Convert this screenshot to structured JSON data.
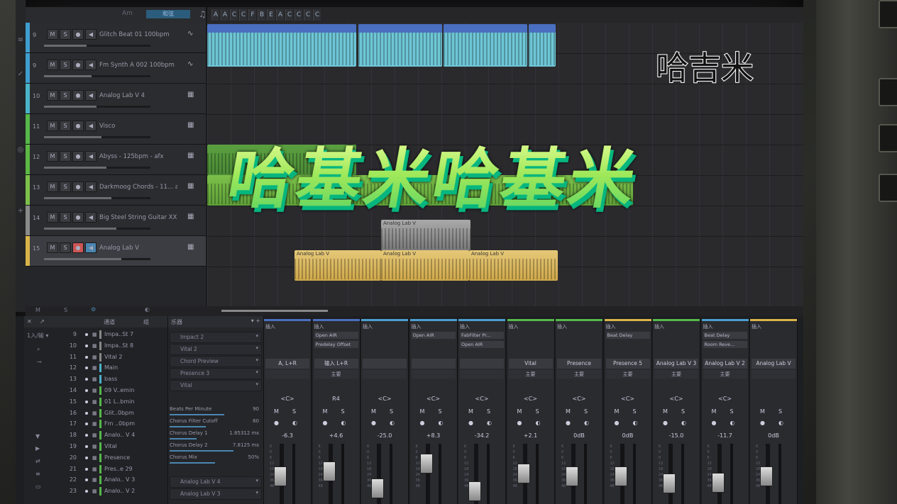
{
  "header": {
    "key_label": "Am",
    "mode_label": "和弦",
    "chords": [
      "A",
      "A",
      "C",
      "C",
      "F",
      "B",
      "E",
      "A",
      "C",
      "C",
      "C",
      "C"
    ]
  },
  "tracks": [
    {
      "num": "9",
      "name": "Glitch Beat 01 100bpm",
      "color": "#3f9ecf",
      "icon": "audio-icon"
    },
    {
      "num": "9",
      "name": "Fm Synth A 002 100bpm",
      "color": "#3f9ecf",
      "icon": "audio-icon"
    },
    {
      "num": "10",
      "name": "Analog Lab V 4",
      "color": "#4ab3c8",
      "icon": "piano-icon"
    },
    {
      "num": "11",
      "name": "Visco",
      "color": "#56b84a",
      "icon": "piano-icon"
    },
    {
      "num": "12",
      "name": "Abyss - 125bpm - afx",
      "color": "#5cb844",
      "icon": "piano-icon"
    },
    {
      "num": "13",
      "name": "Darkmoog Chords - 11... af",
      "color": "#7cc04a",
      "icon": "piano-icon"
    },
    {
      "num": "14",
      "name": "Big Steel String Guitar XXL",
      "color": "#8a8a8a",
      "icon": "piano-icon"
    },
    {
      "num": "15",
      "name": "Analog Lab V",
      "color": "#d9b34a",
      "icon": "piano-icon"
    }
  ],
  "clips": {
    "gray_label": "Analog Lab V",
    "yellow_label_1": "Analog Lab V",
    "yellow_label_2": "Analog Lab V",
    "yellow_label_3": "Analog Lab V"
  },
  "toolbar": {
    "m": "M",
    "s": "S"
  },
  "browser": {
    "tab_channels": "通道",
    "tab_group": "组",
    "rows": [
      {
        "n": "9",
        "t": "Impa..St 7",
        "c": "#888"
      },
      {
        "n": "10",
        "t": "Impa..St 8",
        "c": "#888"
      },
      {
        "n": "11",
        "t": "Vital 2",
        "c": "#888"
      },
      {
        "n": "12",
        "t": "Main",
        "c": "#4ab3c8"
      },
      {
        "n": "13",
        "t": "bass",
        "c": "#4ab3c8"
      },
      {
        "n": "14",
        "t": "09 V..emin",
        "c": "#56b84a"
      },
      {
        "n": "15",
        "t": "01 L..bmin",
        "c": "#56b84a"
      },
      {
        "n": "16",
        "t": "Glit..0bpm",
        "c": "#56b84a"
      },
      {
        "n": "17",
        "t": "Fm ..0bpm",
        "c": "#56b84a"
      },
      {
        "n": "18",
        "t": "Analo.. V 4",
        "c": "#56b84a"
      },
      {
        "n": "19",
        "t": "Vital",
        "c": "#56b84a"
      },
      {
        "n": "20",
        "t": "Presence",
        "c": "#56b84a"
      },
      {
        "n": "21",
        "t": "Pres..e 29",
        "c": "#56b84a"
      },
      {
        "n": "22",
        "t": "Analo.. V 3",
        "c": "#56b84a"
      },
      {
        "n": "23",
        "t": "Analo.. V 2",
        "c": "#56b84a"
      }
    ]
  },
  "inspector": {
    "title": "乐器",
    "items": [
      "Impact 2",
      "Vital 2",
      "Chord Preview",
      "Presence 3",
      "Vital"
    ],
    "params": [
      {
        "label": "Beats Per Minute",
        "value": "90",
        "fill": 0.6
      },
      {
        "label": "Chorus Filter Cutoff",
        "value": "60",
        "fill": 0.4
      },
      {
        "label": "Chorus Delay 1",
        "value": "1.85312 ms",
        "fill": 0.3
      },
      {
        "label": "Chorus Delay 2",
        "value": "7.8125 ms",
        "fill": 0.7
      },
      {
        "label": "Chorus Mix",
        "value": "50%",
        "fill": 0.5
      }
    ],
    "bottom": [
      "Analog Lab V 4",
      "Analog Lab V 3"
    ]
  },
  "strips": [
    {
      "name": "A, L+R",
      "out": "",
      "slots": [],
      "pan": "<C>",
      "vol": "-6.3",
      "color": "#4a6fc0",
      "fader": 0.55
    },
    {
      "name": "输入 L+R",
      "out": "主要",
      "slots": [
        "Open AIR",
        "Predelay Offset"
      ],
      "pan": "R4",
      "vol": "+4.6",
      "color": "#4a6fc0",
      "fader": 0.65
    },
    {
      "name": "",
      "out": "",
      "slots": [],
      "pan": "<C>",
      "vol": "-25.0",
      "color": "#4a9fd0",
      "fader": 0.3
    },
    {
      "name": "",
      "out": "",
      "slots": [
        "Open AIR"
      ],
      "pan": "<C>",
      "vol": "+8.3",
      "color": "#4a9fd0",
      "fader": 0.8
    },
    {
      "name": "",
      "out": "",
      "slots": [
        "FabFilter Pr...",
        "Open AIR"
      ],
      "pan": "<C>",
      "vol": "-34.2",
      "color": "#4a9fd0",
      "fader": 0.25
    },
    {
      "name": "Vital",
      "out": "主要",
      "slots": [],
      "pan": "<C>",
      "vol": "+2.1",
      "color": "#56b84a",
      "fader": 0.6
    },
    {
      "name": "Presence",
      "out": "主要",
      "slots": [],
      "pan": "<C>",
      "vol": "0dB",
      "color": "#56b84a",
      "fader": 0.55
    },
    {
      "name": "Presence 5",
      "out": "主要",
      "slots": [
        "Beat Delay"
      ],
      "pan": "<C>",
      "vol": "0dB",
      "color": "#d9b34a",
      "fader": 0.55
    },
    {
      "name": "Analog Lab V 3",
      "out": "主要",
      "slots": [],
      "pan": "<C>",
      "vol": "-15.0",
      "color": "#56b84a",
      "fader": 0.4
    },
    {
      "name": "Analog Lab V 2",
      "out": "主要",
      "slots": [
        "Beat Delay",
        "Room Reve..."
      ],
      "pan": "<C>",
      "vol": "-11.7",
      "color": "#4a9fd0",
      "fader": 0.42
    },
    {
      "name": "Analog Lab V",
      "out": "",
      "slots": [],
      "pan": "",
      "vol": "0dB",
      "color": "#d9b34a",
      "fader": 0.55
    }
  ],
  "strip_insert_label": "插入",
  "overlay": {
    "title": "哈基米哈基米",
    "tag": "哈吉米"
  }
}
